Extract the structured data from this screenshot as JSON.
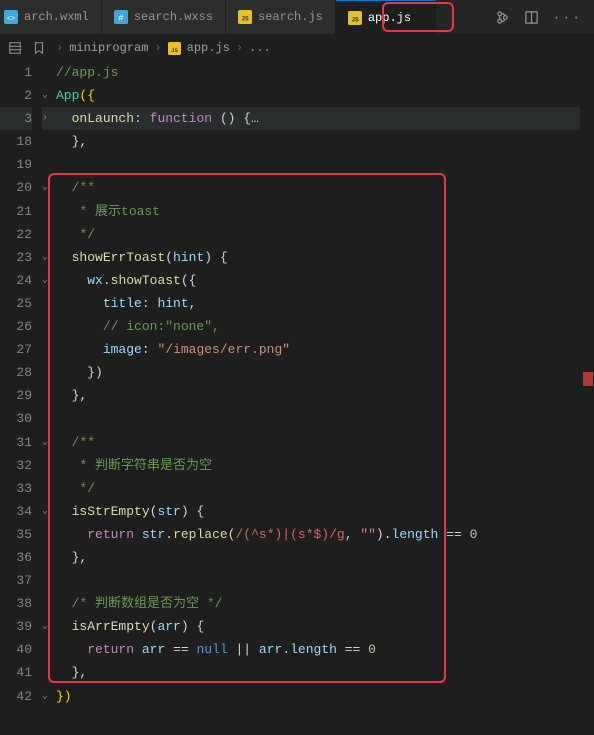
{
  "tabs": [
    {
      "label": "arch.wxml",
      "iconColor": "#41a6d9",
      "glyph": "</>"
    },
    {
      "label": "search.wxss",
      "iconColor": "#41a6d9",
      "glyph": "#"
    },
    {
      "label": "search.js",
      "iconColor": "#e6c02a",
      "glyph": "JS"
    },
    {
      "label": "app.js",
      "iconColor": "#e6c02a",
      "glyph": "JS",
      "active": true,
      "dirty": true
    }
  ],
  "breadcrumb": {
    "root": "miniprogram",
    "file": "app.js",
    "tail": "..."
  },
  "code": {
    "l1_comment": "//app.js",
    "l2_app": "App",
    "l2_open": "({",
    "l3_onlaunch": "onLaunch",
    "l3_func": "function",
    "l3_rest": " () {…",
    "l18": "},",
    "l20": "/**",
    "l21": " * 展示toast",
    "l22": " */",
    "l23_fn": "showErrToast",
    "l23_arg": "hint",
    "l24_obj": "wx",
    "l24_method": "showToast",
    "l25_key": "title",
    "l25_val": "hint",
    "l26": "// icon:\"none\",",
    "l27_key": "image",
    "l27_val": "\"/images/err.png\"",
    "l28": "})",
    "l29": "},",
    "l31": "/**",
    "l32": " * 判断字符串是否为空",
    "l33": " */",
    "l34_fn": "isStrEmpty",
    "l34_arg": "str",
    "l35_ret": "return",
    "l35_var": "str",
    "l35_m1": "replace",
    "l35_regex": "/(^s*)|(s*$)/g",
    "l35_empty": "\"\"",
    "l35_m2": "length",
    "l35_zero": "0",
    "l36": "},",
    "l38": "/* 判断数组是否为空 */",
    "l39_fn": "isArrEmpty",
    "l39_arg": "arr",
    "l40_ret": "return",
    "l40_v": "arr",
    "l40_null": "null",
    "l40_m": "length",
    "l40_zero": "0",
    "l41": "},",
    "l42": "})"
  },
  "lineNumbers": [
    "1",
    "2",
    "3",
    "18",
    "19",
    "20",
    "21",
    "22",
    "23",
    "24",
    "25",
    "26",
    "27",
    "28",
    "29",
    "30",
    "31",
    "32",
    "33",
    "34",
    "35",
    "36",
    "37",
    "38",
    "39",
    "40",
    "41",
    "42"
  ]
}
